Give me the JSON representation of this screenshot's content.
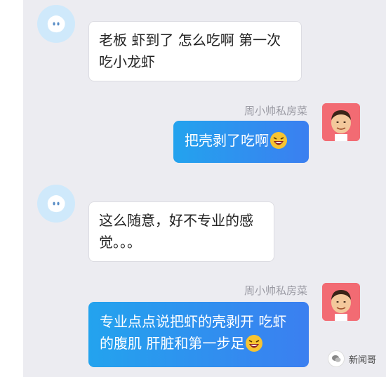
{
  "messages": [
    {
      "side": "left",
      "lines": [
        "老板 虾到了 怎么吃啊 第一次",
        "吃小龙虾"
      ]
    },
    {
      "side": "right",
      "sender": "周小帅私房菜",
      "lines": [
        "把壳剥了吃啊"
      ]
    },
    {
      "side": "left",
      "lines": [
        "这么随意，好不专业的感",
        "觉。。。"
      ]
    },
    {
      "side": "right",
      "sender": "周小帅私房菜",
      "lines": [
        "专业点点说把虾的壳剥开 吃虾",
        "的腹肌 肝脏和第一步足"
      ]
    }
  ],
  "watermark": {
    "text": "新闻哥"
  },
  "colors": {
    "bubble_right_start": "#23a3ee",
    "bubble_right_end": "#3b7ff0",
    "panel_bg": "#ececf1"
  },
  "icons": {
    "left_avatar": "qq-penguin-avatar-icon",
    "right_avatar": "cartoon-man-avatar-icon",
    "emoji": "laughing-emoji-icon"
  }
}
